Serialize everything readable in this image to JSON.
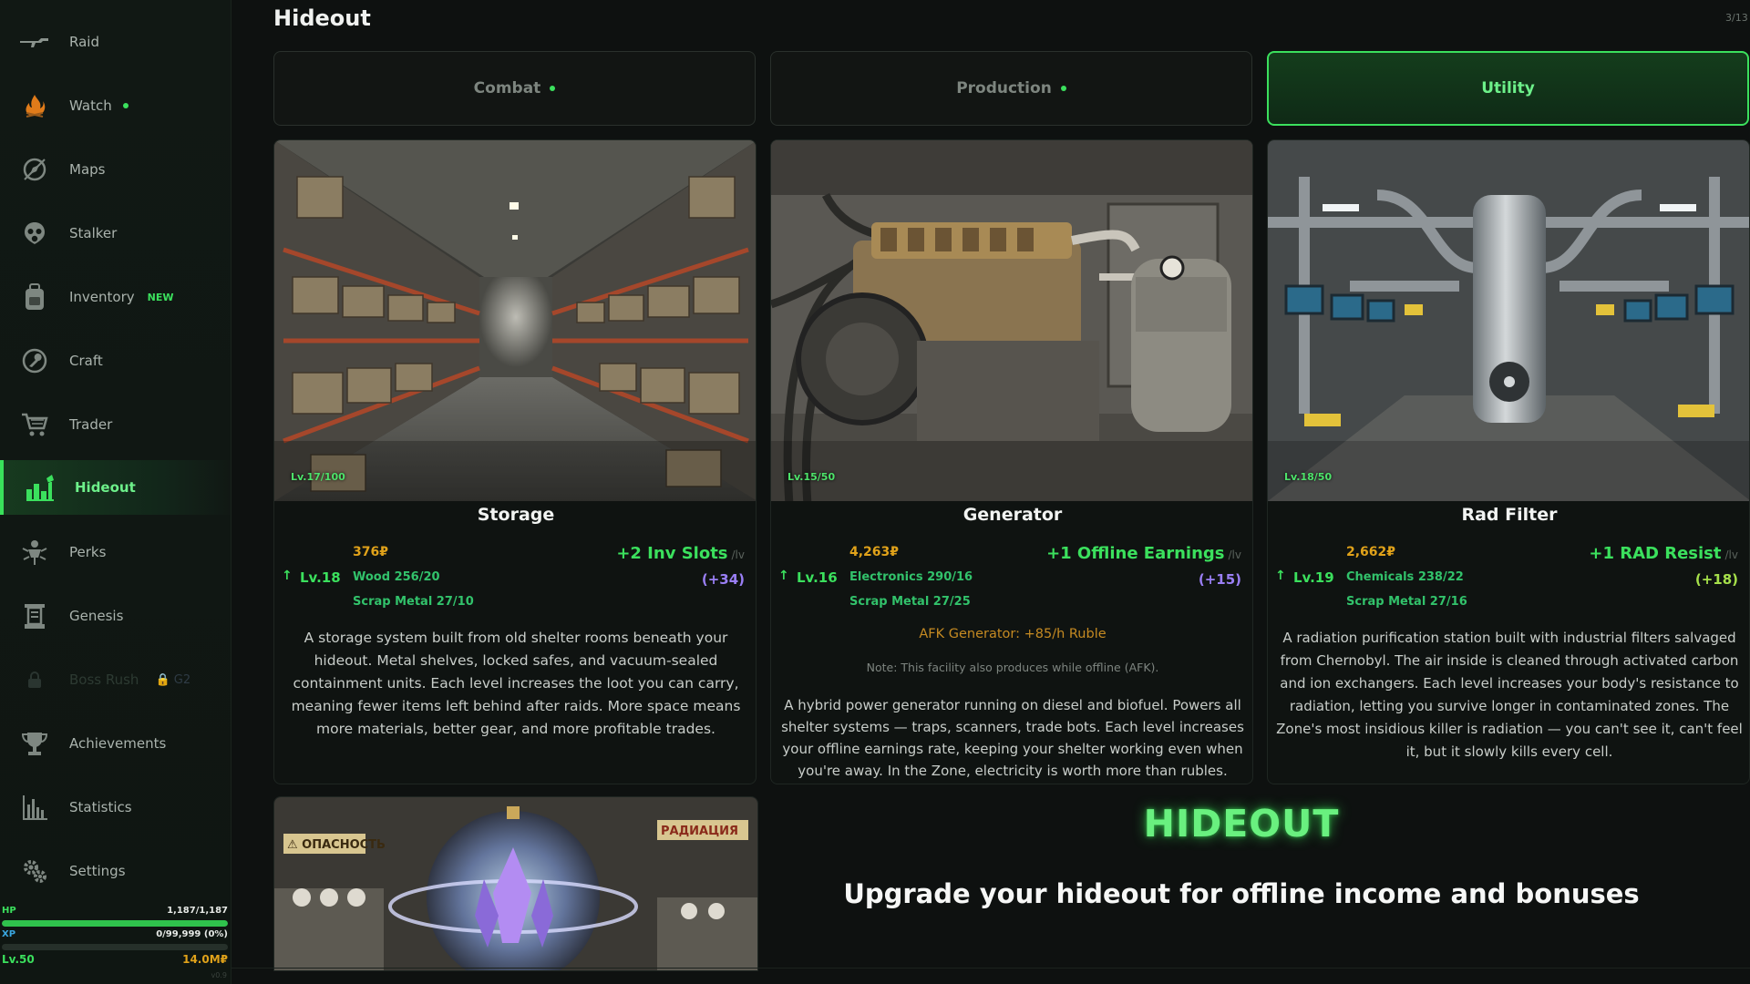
{
  "sidebar": {
    "items": [
      {
        "label": "Raid",
        "icon": "rifle-icon"
      },
      {
        "label": "Watch",
        "icon": "campfire-icon",
        "dot": true
      },
      {
        "label": "Maps",
        "icon": "compass-icon"
      },
      {
        "label": "Stalker",
        "icon": "gasmask-icon"
      },
      {
        "label": "Inventory",
        "icon": "backpack-icon",
        "badge": "NEW"
      },
      {
        "label": "Craft",
        "icon": "wrench-icon"
      },
      {
        "label": "Trader",
        "icon": "cart-icon"
      },
      {
        "label": "Hideout",
        "icon": "bunker-icon",
        "active": true
      },
      {
        "label": "Perks",
        "icon": "perks-icon"
      },
      {
        "label": "Genesis",
        "icon": "lab-icon"
      },
      {
        "label": "Boss Rush",
        "icon": "lock-icon",
        "locked": true,
        "badge": "🔒 G2"
      },
      {
        "label": "Achievements",
        "icon": "trophy-icon"
      },
      {
        "label": "Statistics",
        "icon": "bar-chart-icon"
      },
      {
        "label": "Settings",
        "icon": "gears-icon"
      }
    ],
    "stats": {
      "hp_label": "HP",
      "hp_value": "1,187/1,187",
      "hp_fraction": 1.0,
      "xp_label": "XP",
      "xp_value": "0/99,999 (0%)",
      "xp_fraction": 0.0,
      "level": "Lv.50",
      "money": "14.0M₽",
      "version": "v0.9"
    }
  },
  "header": {
    "title": "Hideout",
    "counter": "3/13"
  },
  "tabs": [
    {
      "label": "Combat",
      "dot": true
    },
    {
      "label": "Production",
      "dot": true
    },
    {
      "label": "Utility",
      "active": true
    }
  ],
  "cards": [
    {
      "name": "Storage",
      "level": "Lv.17/100",
      "cost": "376₽",
      "bonus": "+2 Inv Slots",
      "per": "/lv",
      "next_level": "Lv.18",
      "material_1": "Wood 256/20",
      "material_2": "Scrap Metal 27/10",
      "total": "(+34)",
      "description": "A storage system built from old shelter rooms beneath your hideout. Metal shelves, locked safes, and vacuum-sealed containment units. Each level increases the loot you can carry, meaning fewer items left behind after raids. More space means more materials, better gear, and more profitable trades."
    },
    {
      "name": "Generator",
      "level": "Lv.15/50",
      "cost": "4,263₽",
      "bonus": "+1 Offline Earnings",
      "per": "/lv",
      "next_level": "Lv.16",
      "material_1": "Electronics 290/16",
      "material_2": "Scrap Metal 27/25",
      "total": "(+15)",
      "afk": "AFK Generator: +85/h Ruble",
      "note": "Note: This facility also produces while offline (AFK).",
      "description": "A hybrid power generator running on diesel and biofuel. Powers all shelter systems — traps, scanners, trade bots. Each level increases your offline earnings rate, keeping your shelter working even when you're away. In the Zone, electricity is worth more than rubles."
    },
    {
      "name": "Rad Filter",
      "level": "Lv.18/50",
      "cost": "2,662₽",
      "bonus": "+1 RAD Resist",
      "per": "/lv",
      "next_level": "Lv.19",
      "material_1": "Chemicals 238/22",
      "material_2": "Scrap Metal 27/16",
      "total": "(+18)",
      "description": "A radiation purification station built with industrial filters salvaged from Chernobyl. The air inside is cleaned through activated carbon and ion exchangers. Each level increases your body's resistance to radiation, letting you survive longer in contaminated zones. The Zone's most insidious killer is radiation — you can't see it, can't feel it, but it slowly kills every cell."
    }
  ],
  "bottom_card": {
    "sign_left": "⚠ ОПАСНОСТЬ",
    "sign_right": "РАДИАЦИЯ"
  },
  "promo": {
    "title": "HIDEOUT",
    "subtitle": "Upgrade your hideout for offline income and bonuses"
  },
  "colors": {
    "accent": "#3be05d",
    "gold": "#e0a21a",
    "purple": "#9a7ff5",
    "background": "#0e1110"
  }
}
